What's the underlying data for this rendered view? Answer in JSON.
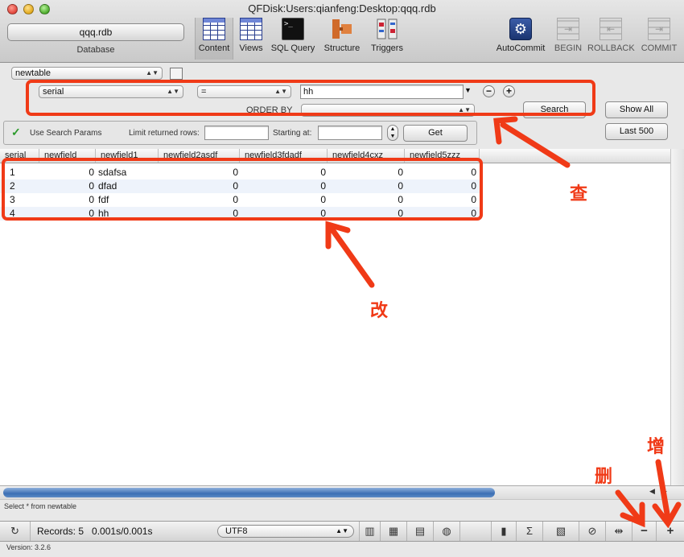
{
  "window": {
    "title": "QFDisk:Users:qianfeng:Desktop:qqq.rdb"
  },
  "database": {
    "name": "qqq.rdb",
    "label": "Database"
  },
  "toolbar": {
    "content": "Content",
    "views": "Views",
    "sql_query": "SQL Query",
    "structure": "Structure",
    "triggers": "Triggers",
    "autocommit": "AutoCommit",
    "begin": "BEGIN",
    "rollback": "ROLLBACK",
    "commit": "COMMIT"
  },
  "search": {
    "table": "newtable",
    "field": "serial",
    "operator": "=",
    "value": "hh",
    "order_by_label": "ORDER BY",
    "order_by_value": "",
    "search_label": "Search",
    "show_all_label": "Show All",
    "last500_label": "Last 500",
    "use_params_label": "Use Search Params",
    "limit_label": "Limit returned rows:",
    "limit_value": "",
    "starting_label": "Starting at:",
    "starting_value": "",
    "get_label": "Get"
  },
  "table": {
    "columns": [
      "serial",
      "newfield",
      "newfield1",
      "newfield2asdf",
      "newfield3fdadf",
      "newfield4cxz",
      "newfield5zzz"
    ],
    "rows": [
      [
        "1",
        "0",
        "sdafsa",
        "0",
        "0",
        "0",
        "0"
      ],
      [
        "2",
        "0",
        "dfad",
        "0",
        "0",
        "0",
        "0"
      ],
      [
        "3",
        "0",
        "fdf",
        "0",
        "0",
        "0",
        "0"
      ],
      [
        "4",
        "0",
        "hh",
        "0",
        "0",
        "0",
        "0"
      ]
    ]
  },
  "status": {
    "sql": "Select * from newtable",
    "records": "Records: 5",
    "timing": "0.001s/0.001s",
    "encoding": "UTF8",
    "version": "Version: 3.2.6"
  },
  "annotations": {
    "query": "查",
    "modify": "改",
    "delete": "删",
    "add": "增"
  },
  "colors": {
    "annotation": "#f03a17",
    "selection": "#3c6fb4"
  }
}
